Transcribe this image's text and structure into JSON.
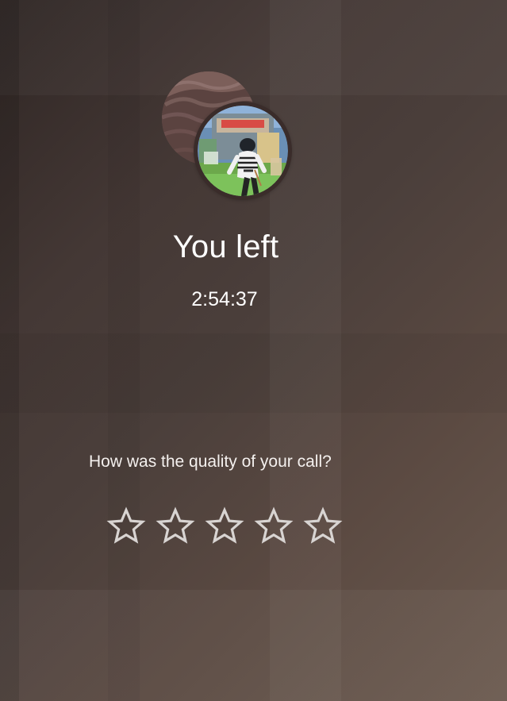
{
  "call_end": {
    "title": "You left",
    "duration": "2:54:37"
  },
  "participants": [
    {
      "role": "secondary",
      "icon": "profile-photo-icon"
    },
    {
      "role": "primary",
      "icon": "profile-photo-icon"
    }
  ],
  "rating": {
    "question": "How was the quality of your call?",
    "stars": [
      {
        "value": 1,
        "icon": "star-outline-icon"
      },
      {
        "value": 2,
        "icon": "star-outline-icon"
      },
      {
        "value": 3,
        "icon": "star-outline-icon"
      },
      {
        "value": 4,
        "icon": "star-outline-icon"
      },
      {
        "value": 5,
        "icon": "star-outline-icon"
      }
    ],
    "selected": 0
  },
  "colors": {
    "text": "#ffffff",
    "star_outline": "#d8d4d2",
    "background_dark": "#2f2624",
    "background_light": "#6b5a4f"
  }
}
